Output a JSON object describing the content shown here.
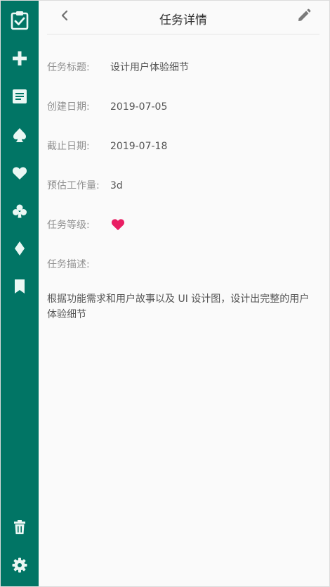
{
  "sidebar": {
    "items": [
      {
        "icon": "clipboard-check-icon"
      },
      {
        "icon": "plus-icon"
      },
      {
        "icon": "note-icon"
      },
      {
        "icon": "spade-icon"
      },
      {
        "icon": "heart-icon"
      },
      {
        "icon": "club-icon"
      },
      {
        "icon": "diamond-icon"
      },
      {
        "icon": "bookmark-icon"
      },
      {
        "icon": "trash-icon"
      },
      {
        "icon": "settings-gear-icon"
      }
    ],
    "background_color": "#017565",
    "icon_color": "#eaf7f4"
  },
  "header": {
    "title": "任务详情",
    "back_icon": "chevron-left-icon",
    "edit_icon": "pencil-icon"
  },
  "details": {
    "title_label": "任务标题:",
    "title_value": "设计用户体验细节",
    "created_label": "创建日期:",
    "created_value": "2019-07-05",
    "deadline_label": "截止日期:",
    "deadline_value": "2019-07-18",
    "estimate_label": "预估工作量:",
    "estimate_value": "3d",
    "level_label": "任务等级:",
    "level_icon": "heart-icon",
    "level_color": "#e91e63",
    "description_label": "任务描述:",
    "description_text": "根据功能需求和用户故事以及 UI 设计图，设计出完整的用户体验细节"
  }
}
